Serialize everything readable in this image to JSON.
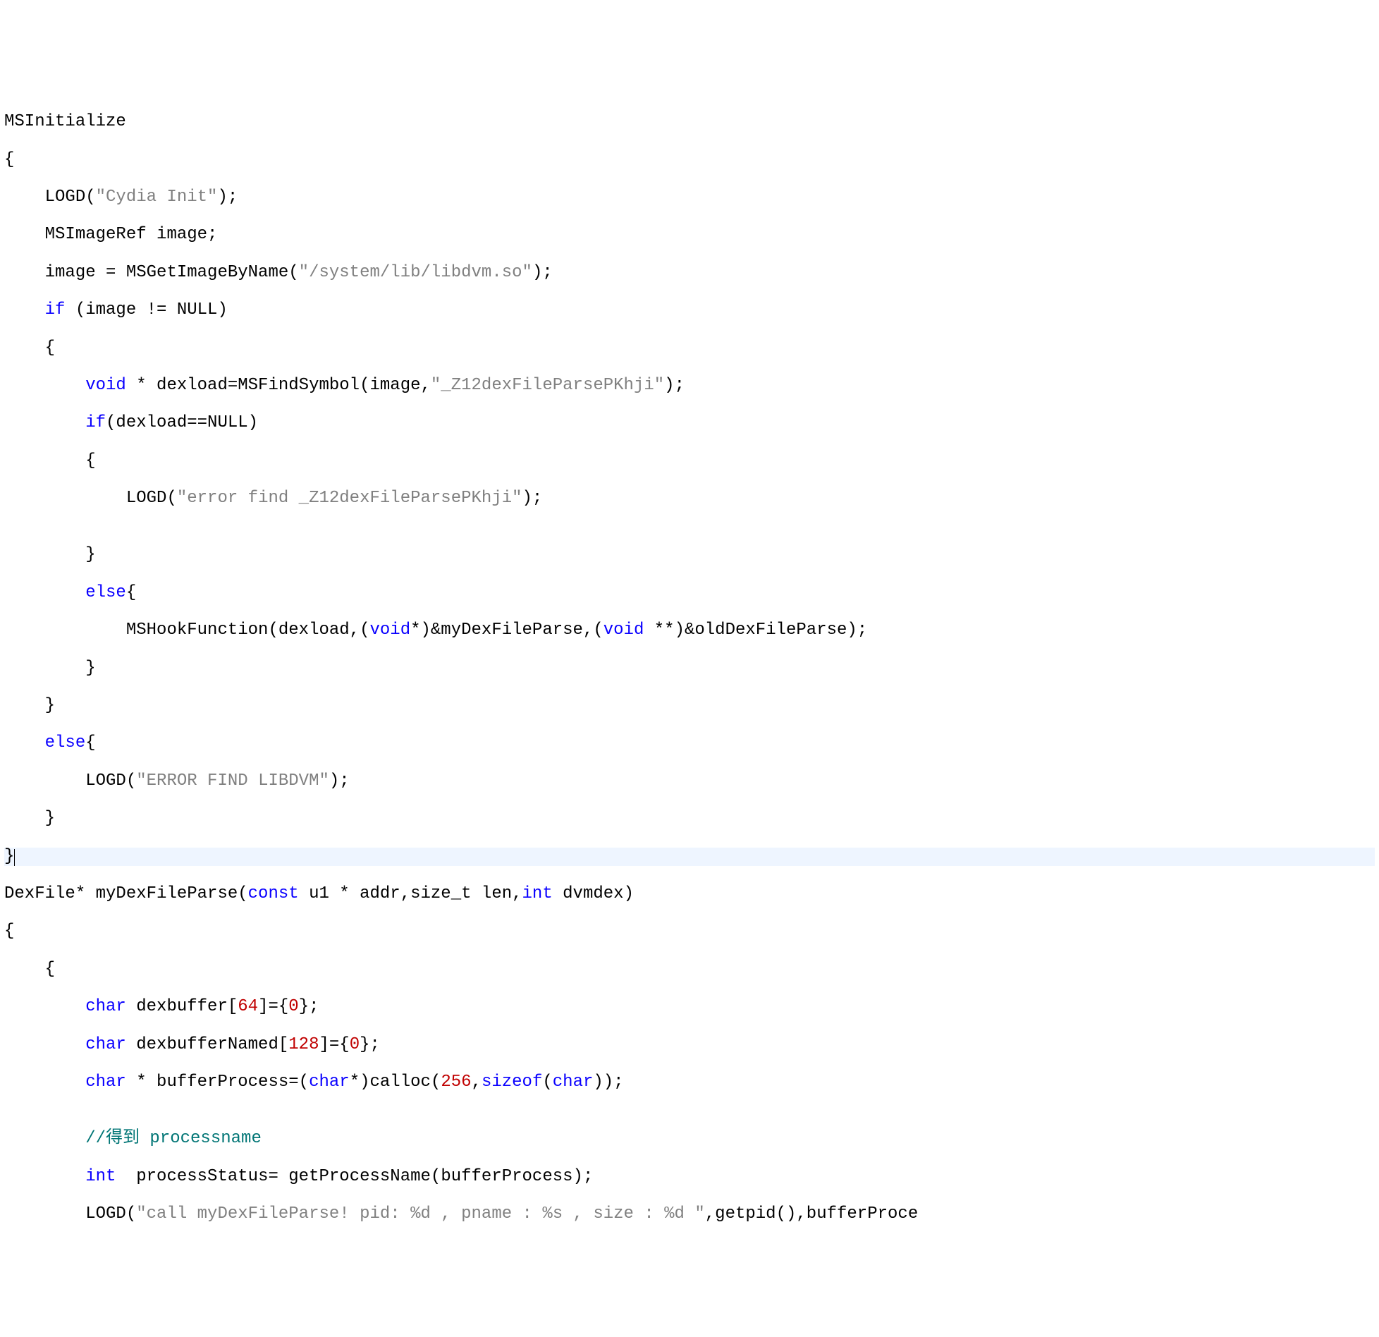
{
  "code": {
    "l0": "MSInitialize",
    "l1a": "{",
    "l2a": "    LOGD(",
    "l2s": "\"Cydia Init\"",
    "l2b": ");",
    "l3": "    MSImageRef image;",
    "l4a": "    image = MSGetImageByName(",
    "l4s": "\"/system/lib/libdvm.so\"",
    "l4b": ");",
    "l5a": "    ",
    "l5k": "if",
    "l5b": " (image != NULL)",
    "l6": "    {",
    "l7a": "        ",
    "l7k": "void",
    "l7b": " * dexload=MSFindSymbol(image,",
    "l7s": "\"_Z12dexFileParsePKhji\"",
    "l7c": ");",
    "l8a": "        ",
    "l8k": "if",
    "l8b": "(dexload==NULL)",
    "l9": "        {",
    "l10a": "            LOGD(",
    "l10s": "\"error find _Z12dexFileParsePKhji\"",
    "l10b": ");",
    "l11": "",
    "l12": "        }",
    "l13a": "        ",
    "l13k": "else",
    "l13b": "{",
    "l14a": "            MSHookFunction(dexload,(",
    "l14k1": "void",
    "l14b": "*)&myDexFileParse,(",
    "l14k2": "void",
    "l14c": " **)&oldDexFileParse);",
    "l15": "        }",
    "l16": "    }",
    "l17a": "    ",
    "l17k": "else",
    "l17b": "{",
    "l18a": "        LOGD(",
    "l18s": "\"ERROR FIND LIBDVM\"",
    "l18b": ");",
    "l19": "    }",
    "l20": "}",
    "l21a": "DexFile* myDexFileParse(",
    "l21k1": "const",
    "l21b": " u1 * addr,size_t len,",
    "l21k2": "int",
    "l21c": " dvmdex)",
    "l22": "{",
    "l23": "    {",
    "l24a": "        ",
    "l24k": "char",
    "l24b": " dexbuffer[",
    "l24n": "64",
    "l24c": "]={",
    "l24n2": "0",
    "l24d": "};",
    "l25a": "        ",
    "l25k": "char",
    "l25b": " dexbufferNamed[",
    "l25n": "128",
    "l25c": "]={",
    "l25n2": "0",
    "l25d": "};",
    "l26a": "        ",
    "l26k1": "char",
    "l26b": " * bufferProcess=(",
    "l26k2": "char",
    "l26c": "*)calloc(",
    "l26n": "256",
    "l26d": ",",
    "l26k3": "sizeof",
    "l26e": "(",
    "l26k4": "char",
    "l26f": "));",
    "l27": "",
    "l28a": "        ",
    "l28c": "//得到 processname",
    "l29a": "        ",
    "l29k": "int",
    "l29b": "  processStatus= getProcessName(bufferProcess);",
    "l30a": "        LOGD(",
    "l30s": "\"call myDexFileParse! pid: %d , pname : %s , size : %d \"",
    "l30b": ",getpid(),bufferProce"
  }
}
